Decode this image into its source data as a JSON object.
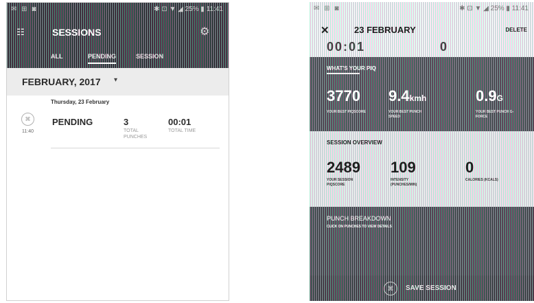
{
  "left": {
    "status": {
      "left_icons": "✉ ⊞ ◙",
      "right_text": "✱ ⊡ ▼ ◢ 25% ▮ 11:41"
    },
    "menu_glyph": "☷",
    "title": "SESSIONS",
    "gear_glyph": "⚙",
    "tabs": [
      "ALL",
      "PENDING",
      "SESSION"
    ],
    "month": "FEBRUARY, 2017",
    "dropdown_glyph": "▾",
    "date_heading": "Thursday, 23 February",
    "session": {
      "icon_glyph": "⌘",
      "time": "11:40",
      "status": "PENDING",
      "punches_value": "3",
      "punches_label": "TOTAL PUNCHES",
      "time_value": "00:01",
      "time_label": "TOTAL TIME"
    }
  },
  "right": {
    "status": {
      "left_icons": "✉ ⊞ ◙",
      "right_text": "✱ ⊡ ▼ ◢ 25% ▮ 11:41"
    },
    "close_glyph": "✕",
    "title": "23 FEBRUARY",
    "delete_label": "DELETE",
    "scrolled_left": "00:01",
    "scrolled_right": "0",
    "piq": {
      "title": "WHAT'S YOUR PIQ",
      "score_value": "3770",
      "score_label": "YOUR BEST PIQSCORE",
      "speed_value": "9.4",
      "speed_unit": "kmh",
      "speed_label": "YOUR BEST PUNCH SPEED",
      "gforce_value": "0.9",
      "gforce_unit": "G",
      "gforce_label": "YOUR BEST PUNCH G-FORCE"
    },
    "overview": {
      "title": "SESSION OVERVIEW",
      "piqscore_value": "2489",
      "piqscore_label": "YOUR SESSION PIQSCORE",
      "intensity_value": "109",
      "intensity_label": "INTENSITY (PUNCHES/MIN)",
      "calories_value": "0",
      "calories_label": "CALORIES (KCALS)"
    },
    "breakdown": {
      "title": "PUNCH BREAKDOWN",
      "subtitle": "CLICK ON PUNCHES TO VIEW DETAILS"
    },
    "save": {
      "icon_glyph": "⌘",
      "label": "SAVE SESSION"
    }
  }
}
